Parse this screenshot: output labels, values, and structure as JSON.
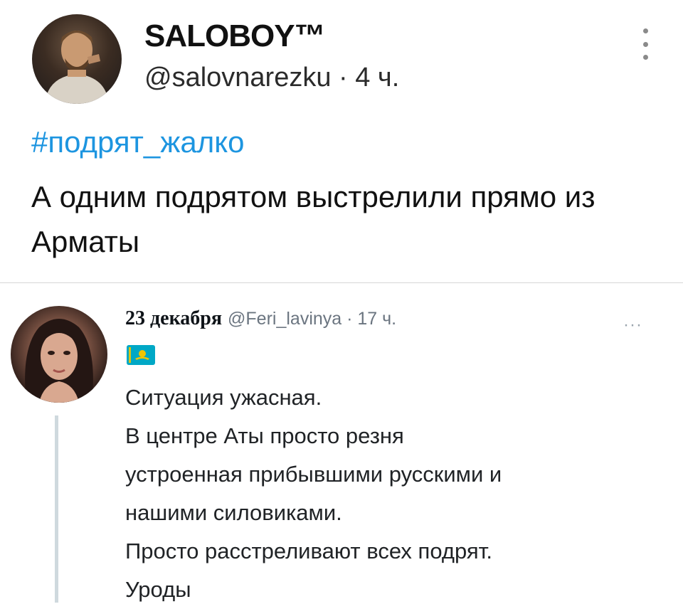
{
  "top_tweet": {
    "author_name": "SALOBOY™",
    "handle_time": "@salovnarezku · 4 ч.",
    "hashtag": "#подрят_жалко",
    "text": "А одним подрятом выстрелили прямо из Арматы"
  },
  "quoted_tweet": {
    "date": "23 декабря",
    "handle_time": "@Feri_lavinya · 17 ч.",
    "more_label": "···",
    "flag": "kazakhstan-flag-icon",
    "lines": [
      "Ситуация ужасная.",
      "В центре Аты просто резня",
      "устроенная прибывшими русскими и",
      "нашими силовиками.",
      "Просто расстреливают всех подрят.",
      "Уроды"
    ]
  },
  "colors": {
    "hashtag": "#1d95e0",
    "muted": "#6b7580",
    "kz_flag_blue": "#00a8c6",
    "kz_flag_gold": "#f2c500"
  }
}
